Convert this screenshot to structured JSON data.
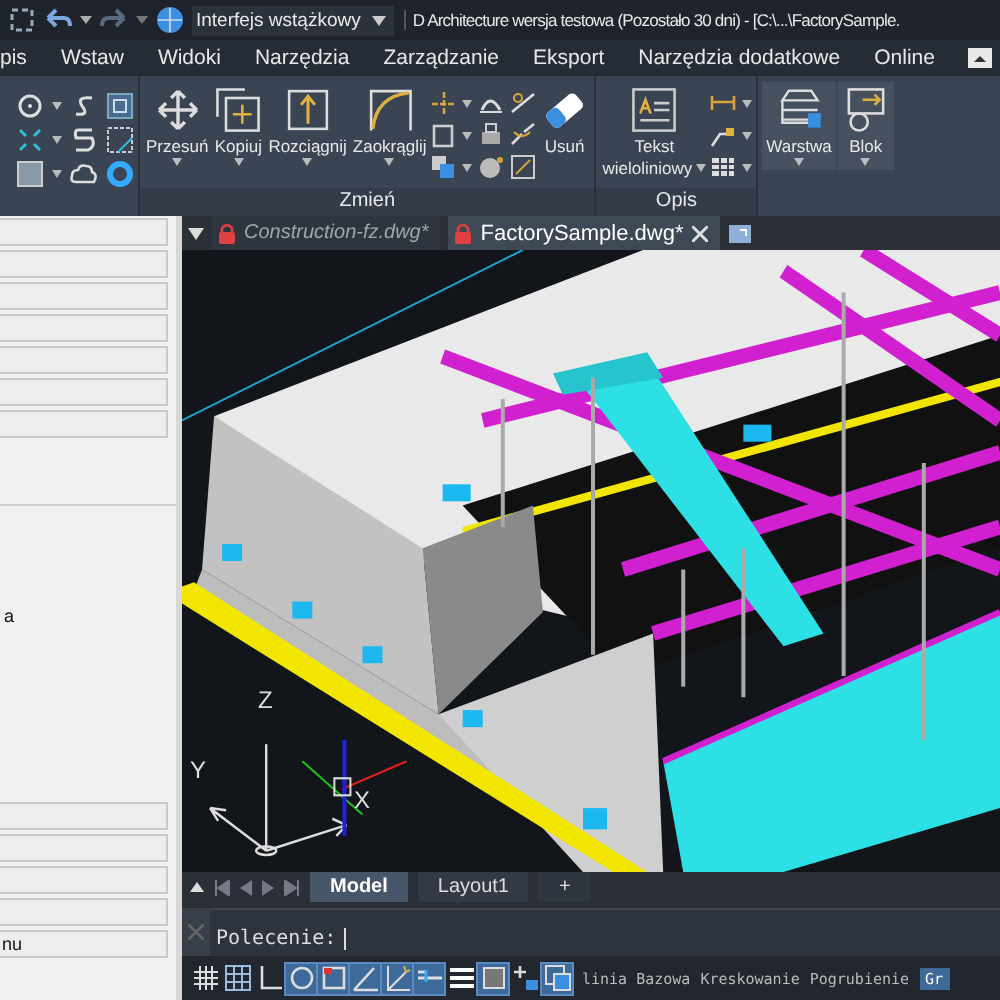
{
  "title_bar": {
    "workspace": "Interfejs wstążkowy",
    "title": "D Architecture wersja testowa (Pozostało 30 dni) - [C:\\...\\FactorySample."
  },
  "menu_tabs": [
    "pis",
    "Wstaw",
    "Widoki",
    "Narzędzia",
    "Zarządzanie",
    "Eksport",
    "Narzędzia dodatkowe",
    "Online"
  ],
  "ribbon": {
    "edit_buttons": [
      "Przesuń",
      "Kopiuj",
      "Rozciągnij",
      "Zaokrąglij",
      "Usuń"
    ],
    "edit_label": "Zmień",
    "annotate_button": [
      "Tekst",
      "wieloliniowy"
    ],
    "annotate_label": "Opis",
    "layer_buttons": [
      "Warstwa",
      "Blok"
    ]
  },
  "side_panel": {
    "texts": [
      "a",
      "nu"
    ]
  },
  "doc_tabs": [
    {
      "label": "Construction-fz.dwg*",
      "selected": false
    },
    {
      "label": "FactorySample.dwg*",
      "selected": true
    }
  ],
  "viewport": {
    "axis_labels": [
      "Z",
      "Y",
      "X"
    ]
  },
  "layout_tabs": [
    {
      "label": "Model",
      "selected": true
    },
    {
      "label": "Layout1",
      "selected": false
    }
  ],
  "add_tab": "+",
  "command": {
    "prompt": "Polecenie:"
  },
  "status_bar": {
    "toggles": [
      {
        "on": false
      },
      {
        "on": false
      },
      {
        "on": false
      },
      {
        "on": true
      },
      {
        "on": true
      },
      {
        "on": true
      },
      {
        "on": true
      },
      {
        "on": true
      },
      {
        "on": false
      },
      {
        "on": true
      },
      {
        "on": false
      },
      {
        "on": true
      }
    ],
    "labels": [
      {
        "text": "linia Bazowa",
        "on": false
      },
      {
        "text": "Kreskowanie",
        "on": false
      },
      {
        "text": "Pogrubienie",
        "on": false
      },
      {
        "text": "Gr",
        "on": true
      }
    ]
  }
}
